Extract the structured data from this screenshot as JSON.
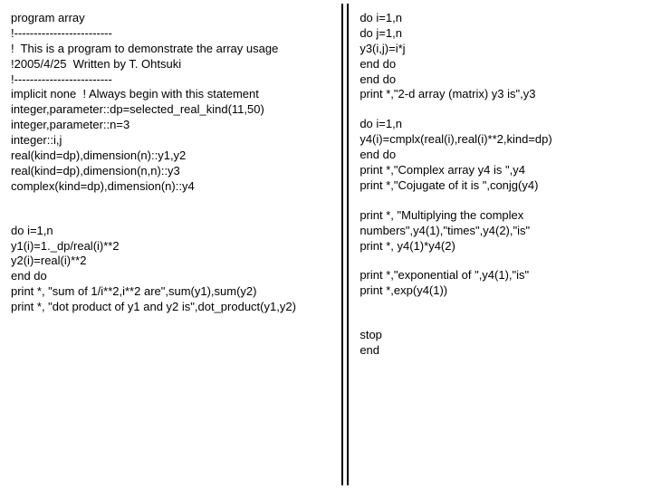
{
  "left": {
    "l01": "program array",
    "l02": "!-------------------------",
    "l03": "!  This is a program to demonstrate the array usage",
    "l04": "!2005/4/25  Written by T. Ohtsuki",
    "l05": "!-------------------------",
    "l06": "implicit none  ! Always begin with this statement",
    "l07": "integer,parameter::dp=selected_real_kind(11,50)",
    "l08": "integer,parameter::n=3",
    "l09": "integer::i,j",
    "l10": "real(kind=dp),dimension(n)::y1,y2",
    "l11": "real(kind=dp),dimension(n,n)::y3",
    "l12": "complex(kind=dp),dimension(n)::y4",
    "l13": "do i=1,n",
    "l14": "y1(i)=1._dp/real(i)**2",
    "l15": "y2(i)=real(i)**2",
    "l16": "end do",
    "l17": "print *, \"sum of 1/i**2,i**2 are\",sum(y1),sum(y2)",
    "l18": "print *, \"dot product of y1 and y2 is\",dot_product(y1,y2)"
  },
  "right": {
    "r01": "do i=1,n",
    "r02": "do j=1,n",
    "r03": "y3(i,j)=i*j",
    "r04": "end do",
    "r05": "end do",
    "r06": "print *,\"2-d array (matrix) y3 is\",y3",
    "r07": "do i=1,n",
    "r08": "y4(i)=cmplx(real(i),real(i)**2,kind=dp)",
    "r09": "end do",
    "r10": "print *,\"Complex array y4 is \",y4",
    "r11": "print *,\"Cojugate of it is \",conjg(y4)",
    "r12": "print *, \"Multiplying the complex numbers\",y4(1),\"times\",y4(2),\"is\"",
    "r13": "print *, y4(1)*y4(2)",
    "r14": "print *,\"exponential of \",y4(1),\"is\"",
    "r15": "print *,exp(y4(1))",
    "r16": "stop",
    "r17": "end"
  }
}
